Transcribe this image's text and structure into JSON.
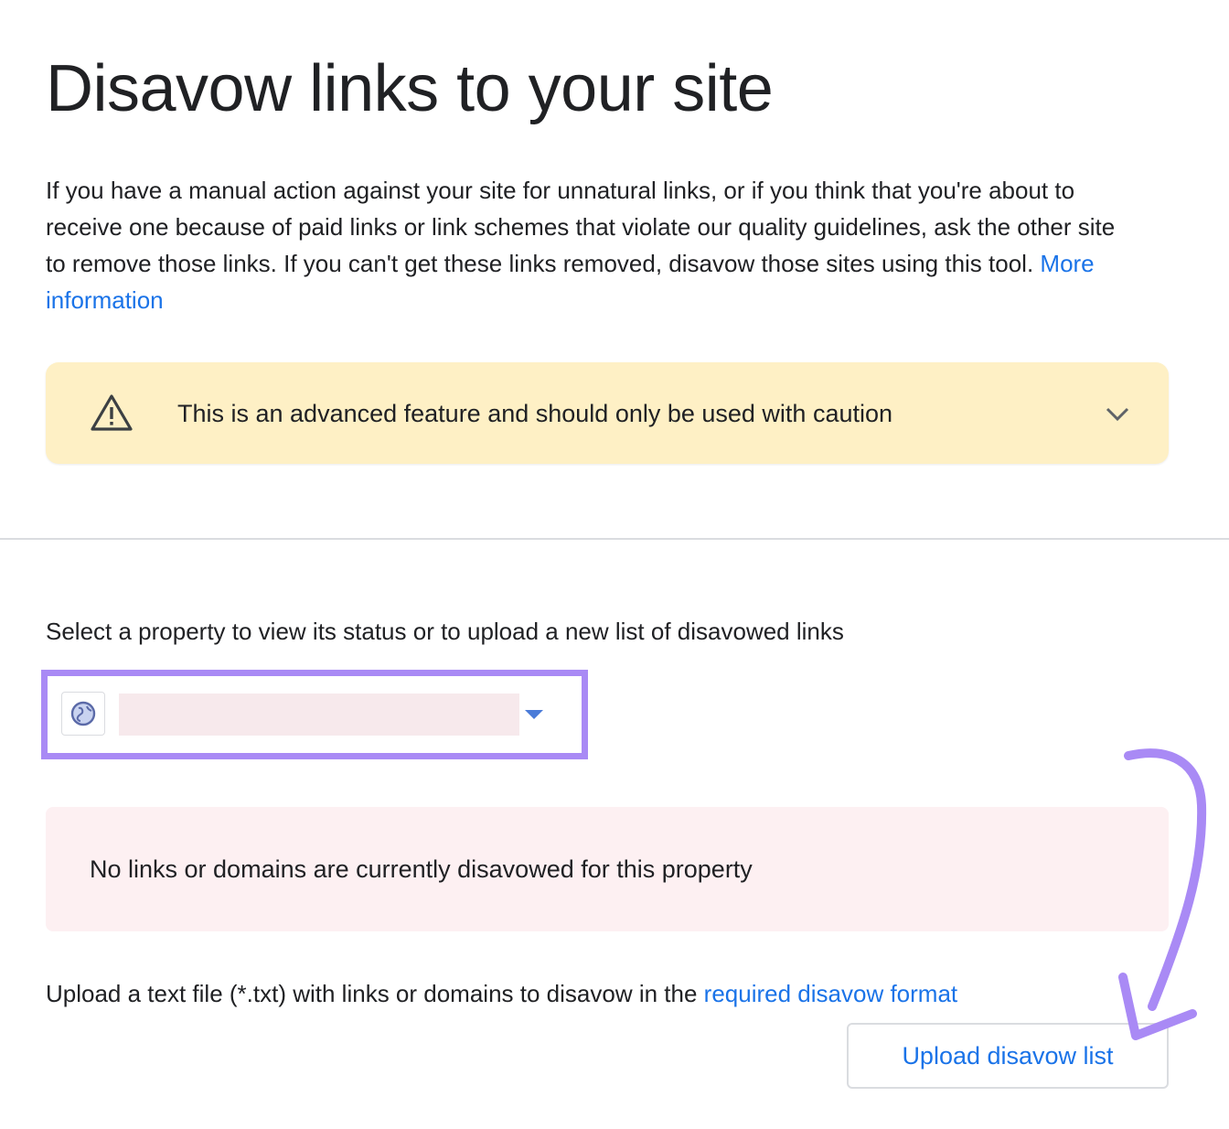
{
  "page": {
    "title": "Disavow links to your site",
    "intro_text": "If you have a manual action against your site for unnatural links, or if you think that you're about to receive one because of paid links or link schemes that violate our quality guidelines, ask the other site to remove those links. If you can't get these links removed, disavow those sites using this tool.",
    "more_info_link": "More information"
  },
  "caution": {
    "text": "This is an advanced feature and should only be used with caution",
    "icon": "warning-triangle-icon",
    "toggle_icon": "chevron-down-icon",
    "background": "#fef0c5"
  },
  "property_selector": {
    "label": "Select a property to view its status or to upload a new list of disavowed links",
    "icon": "globe-icon",
    "selected_value": "",
    "dropdown_icon": "caret-down-icon",
    "highlight_color": "#a98af5"
  },
  "status": {
    "message": "No links or domains are currently disavowed for this property",
    "background": "#fdf0f2"
  },
  "upload": {
    "info_text": "Upload a text file (*.txt) with links or domains to disavow in the",
    "format_link": "required disavow format",
    "button_label": "Upload disavow list"
  },
  "colors": {
    "link": "#1a73e8",
    "text": "#202124",
    "annotation": "#a98af5"
  }
}
